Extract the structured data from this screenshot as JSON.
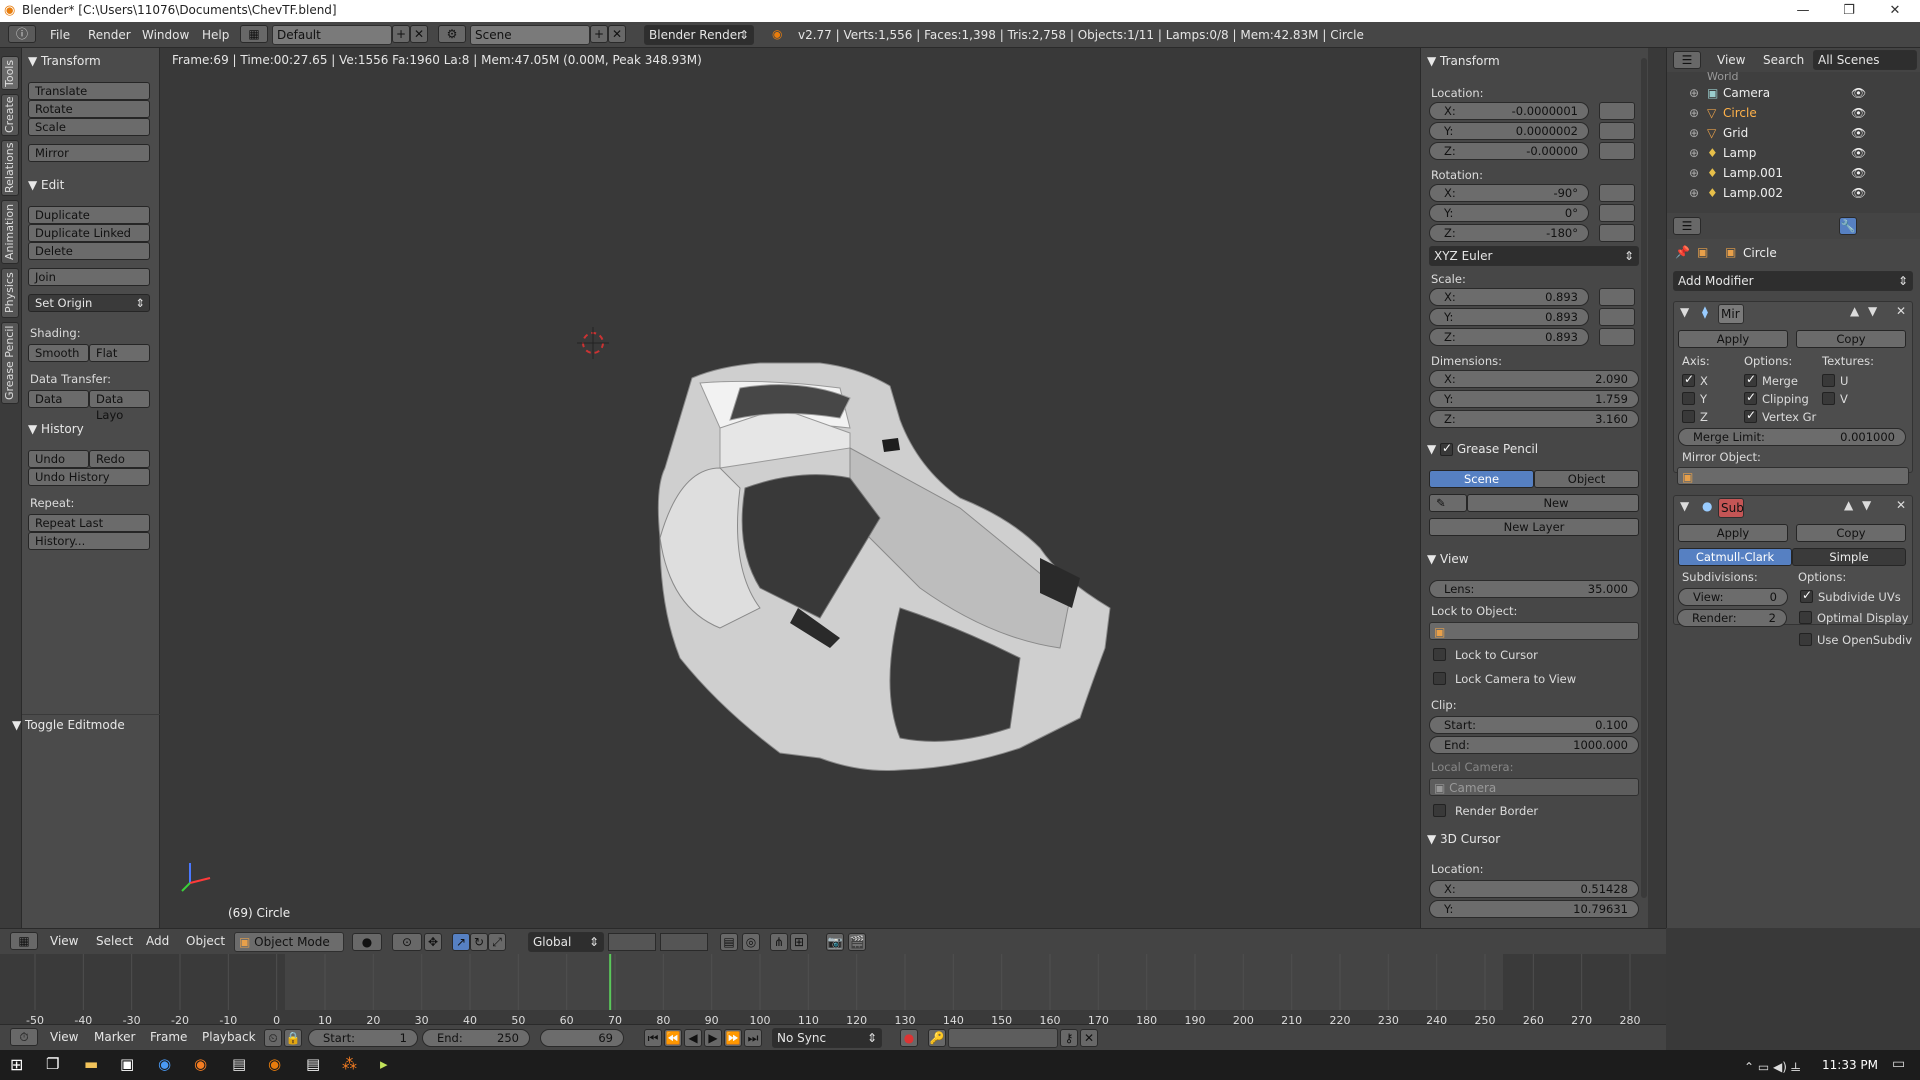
{
  "window": {
    "title": "Blender* [C:\\Users\\11076\\Documents\\ChevTF.blend]"
  },
  "infobar": {
    "menus": [
      "File",
      "Render",
      "Window",
      "Help"
    ],
    "screen": "Default",
    "scene": "Scene",
    "engine": "Blender Render",
    "stats": "v2.77 | Verts:1,556 | Faces:1,398 | Tris:2,758 | Objects:1/11 | Lamps:0/8 | Mem:42.83M | Circle"
  },
  "tabs": [
    "Tools",
    "Create",
    "Relations",
    "Animation",
    "Physics",
    "Grease Pencil"
  ],
  "toolshelf": {
    "transform": {
      "title": "Transform",
      "buttons": [
        "Translate",
        "Rotate",
        "Scale",
        "Mirror"
      ]
    },
    "edit": {
      "title": "Edit",
      "buttons": [
        "Duplicate",
        "Duplicate Linked",
        "Delete",
        "Join"
      ],
      "set_origin": "Set Origin",
      "shading_label": "Shading:",
      "smooth": "Smooth",
      "flat": "Flat",
      "data_transfer_label": "Data Transfer:",
      "data": "Data",
      "data_layo": "Data Layo"
    },
    "history": {
      "title": "History",
      "undo": "Undo",
      "redo": "Redo",
      "undo_history": "Undo History",
      "repeat_label": "Repeat:",
      "repeat_last": "Repeat Last",
      "history_btn": "History..."
    },
    "toggle_editmode": "Toggle Editmode"
  },
  "viewport": {
    "status": "Frame:69 | Time:00:27.65 | Ve:1556 Fa:1960 La:8 | Mem:47.05M (0.00M, Peak 348.93M)",
    "object_label": "(69) Circle"
  },
  "properties": {
    "transform_title": "Transform",
    "location_label": "Location:",
    "location": {
      "x": "-0.0000001",
      "y": "0.0000002",
      "z": "-0.00000"
    },
    "rotation_label": "Rotation:",
    "rotation": {
      "x": "-90°",
      "y": "0°",
      "z": "-180°"
    },
    "rotation_mode": "XYZ Euler",
    "scale_label": "Scale:",
    "scale": {
      "x": "0.893",
      "y": "0.893",
      "z": "0.893"
    },
    "dimensions_label": "Dimensions:",
    "dimensions": {
      "x": "2.090",
      "y": "1.759",
      "z": "3.160"
    },
    "grease_pencil_title": "Grease Pencil",
    "gp_scene": "Scene",
    "gp_object": "Object",
    "gp_new": "New",
    "gp_new_layer": "New Layer",
    "view_title": "View",
    "lens_label": "Lens:",
    "lens": "35.000",
    "lock_to_object": "Lock to Object:",
    "lock_to_cursor": "Lock to Cursor",
    "lock_camera": "Lock Camera to View",
    "clip_label": "Clip:",
    "clip_start_label": "Start:",
    "clip_start": "0.100",
    "clip_end_label": "End:",
    "clip_end": "1000.000",
    "local_camera": "Local Camera:",
    "camera": "Camera",
    "render_border": "Render Border",
    "cursor_title": "3D Cursor",
    "cursor_location_label": "Location:",
    "cursor": {
      "x": "0.51428",
      "y": "10.79631"
    },
    "axis_x": "X:",
    "axis_y": "Y:",
    "axis_z": "Z:"
  },
  "outliner": {
    "menus": [
      "View",
      "Search"
    ],
    "scenes": "All Scenes",
    "items": [
      "World",
      "Camera",
      "Circle",
      "Grid",
      "Lamp",
      "Lamp.001",
      "Lamp.002"
    ]
  },
  "modifiers": {
    "object": "Circle",
    "add_modifier": "Add Modifier",
    "mirror": {
      "name": "Mir",
      "apply": "Apply",
      "copy": "Copy",
      "axis_label": "Axis:",
      "options_label": "Options:",
      "textures_label": "Textures:",
      "x": "X",
      "y": "Y",
      "z": "Z",
      "merge": "Merge",
      "clipping": "Clipping",
      "vertex_gr": "Vertex Gr",
      "u": "U",
      "v": "V",
      "merge_limit_label": "Merge Limit:",
      "merge_limit": "0.001000",
      "mirror_object": "Mirror Object:"
    },
    "subsurf": {
      "name": "Sub",
      "apply": "Apply",
      "copy": "Copy",
      "catmull": "Catmull-Clark",
      "simple": "Simple",
      "subdivisions_label": "Subdivisions:",
      "options_label": "Options:",
      "view_label": "View:",
      "view": "0",
      "render_label": "Render:",
      "render": "2",
      "subdivide_uvs": "Subdivide UVs",
      "optimal_display": "Optimal Display",
      "use_opensubdiv": "Use OpenSubdiv"
    }
  },
  "view3d_header": {
    "menus": [
      "View",
      "Select",
      "Add",
      "Object"
    ],
    "mode": "Object Mode",
    "orientation": "Global"
  },
  "timeline": {
    "ticks": [
      -50,
      -40,
      -30,
      -20,
      -10,
      0,
      10,
      20,
      30,
      40,
      50,
      60,
      70,
      80,
      90,
      100,
      110,
      120,
      130,
      140,
      150,
      160,
      170,
      180,
      190,
      200,
      210,
      220,
      230,
      240,
      250,
      260,
      270,
      280
    ],
    "current_frame": 69,
    "menus": [
      "View",
      "Marker",
      "Frame",
      "Playback"
    ],
    "start_label": "Start:",
    "start": "1",
    "end_label": "End:",
    "end": "250",
    "frame": "69",
    "sync": "No Sync"
  },
  "taskbar": {
    "time": "11:33 PM"
  }
}
